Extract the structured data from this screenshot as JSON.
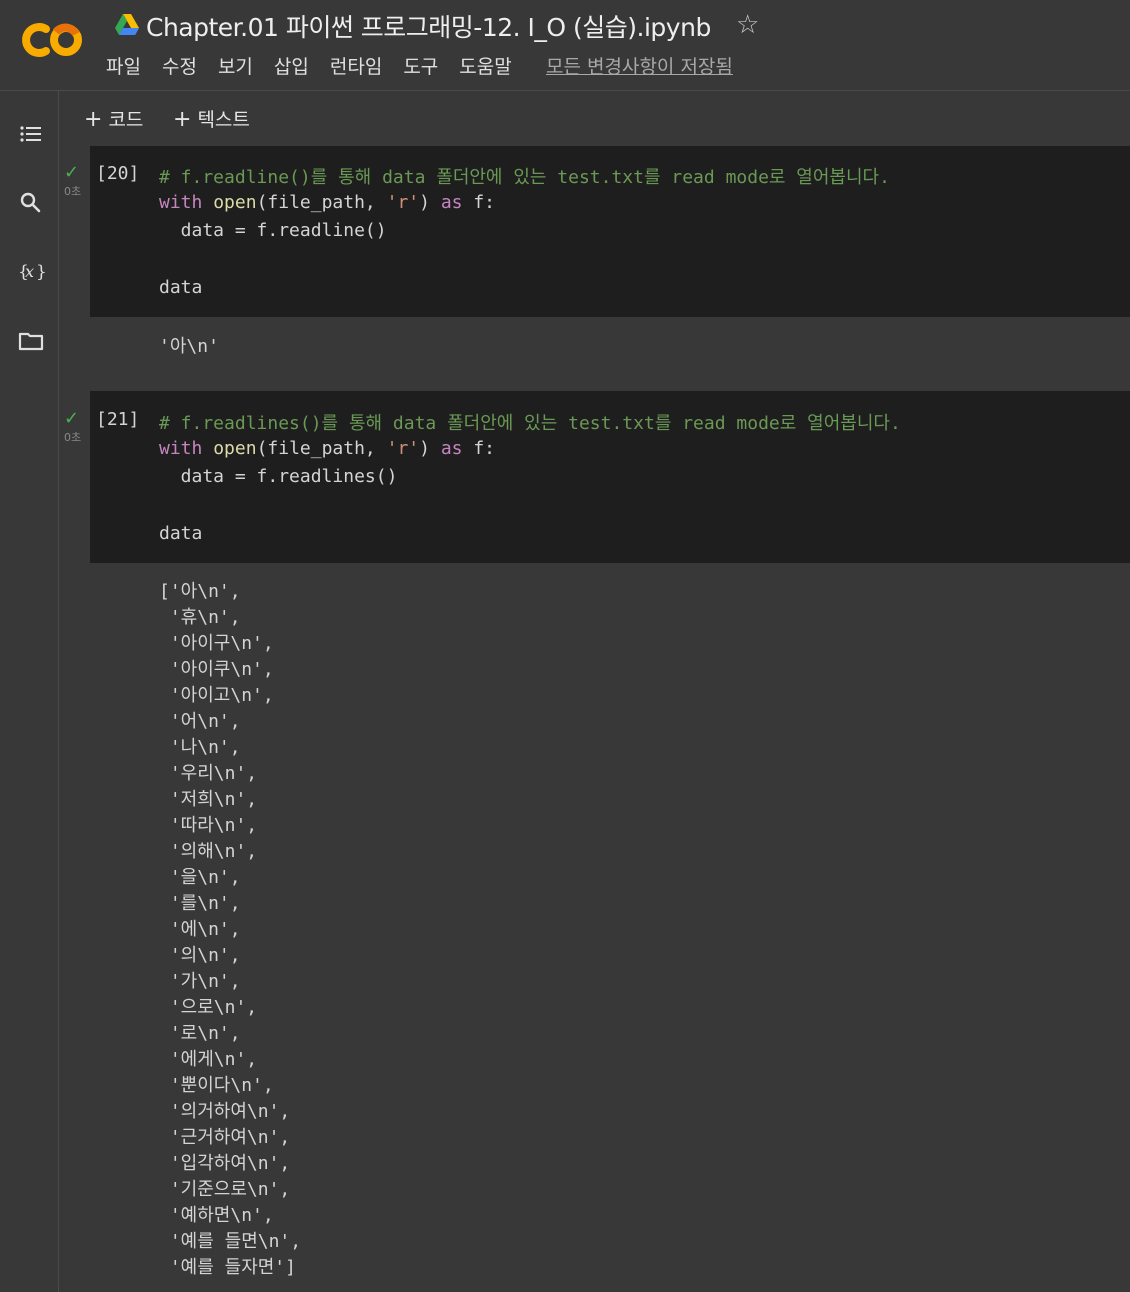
{
  "header": {
    "title": "Chapter.01 파이썬 프로그래밍-12. I_O (실습).ipynb",
    "star_icon": "star-outline-icon",
    "menu": [
      "파일",
      "수정",
      "보기",
      "삽입",
      "런타임",
      "도구",
      "도움말"
    ],
    "saved_status": "모든 변경사항이 저장됨"
  },
  "sidebar": {
    "icons": [
      "table-of-contents-icon",
      "search-icon",
      "variables-icon",
      "files-folder-icon"
    ]
  },
  "toolbar": {
    "add_code": "코드",
    "add_text": "텍스트"
  },
  "cells": [
    {
      "prompt": "[20]",
      "time": "0초",
      "code": {
        "comment": "# f.readline()를 통해 data 폴더안에 있는 test.txt를 read mode로 열어봅니다.",
        "with_kw": "with",
        "open_fn": "open",
        "open_args_1": "(file_path, ",
        "mode_str": "'r'",
        "paren": ") ",
        "as_kw": "as",
        "target": " f:",
        "assign": "  data = f.readline()",
        "data_line": "data"
      },
      "output": [
        "'아\\n'"
      ]
    },
    {
      "prompt": "[21]",
      "time": "0초",
      "code": {
        "comment": "# f.readlines()를 통해 data 폴더안에 있는 test.txt를 read mode로 열어봅니다.",
        "with_kw": "with",
        "open_fn": "open",
        "open_args_1": "(file_path, ",
        "mode_str": "'r'",
        "paren": ") ",
        "as_kw": "as",
        "target": " f:",
        "assign": "  data = f.readlines()",
        "data_line": "data"
      },
      "output": [
        "['아\\n',",
        " '휴\\n',",
        " '아이구\\n',",
        " '아이쿠\\n',",
        " '아이고\\n',",
        " '어\\n',",
        " '나\\n',",
        " '우리\\n',",
        " '저희\\n',",
        " '따라\\n',",
        " '의해\\n',",
        " '을\\n',",
        " '를\\n',",
        " '에\\n',",
        " '의\\n',",
        " '가\\n',",
        " '으로\\n',",
        " '로\\n',",
        " '에게\\n',",
        " '뿐이다\\n',",
        " '의거하여\\n',",
        " '근거하여\\n',",
        " '입각하여\\n',",
        " '기준으로\\n',",
        " '예하면\\n',",
        " '예를 들면\\n',",
        " '예를 들자면']"
      ]
    }
  ]
}
